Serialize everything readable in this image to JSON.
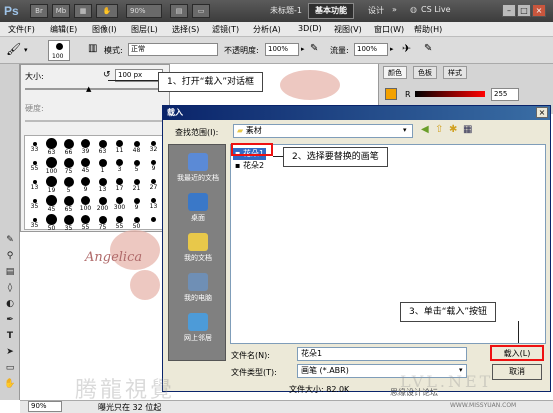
{
  "app": {
    "logo": "Ps",
    "buttons": [
      "Br",
      "Mb"
    ],
    "zoom": "90%",
    "doc_title": "未标题-1",
    "workspace_active": "基本功能",
    "workspace_other": "设计",
    "more": "»",
    "cslive": "CS Live",
    "window_buttons": [
      "–",
      "□",
      "×"
    ]
  },
  "menu": [
    "文件(F)",
    "编辑(E)",
    "图像(I)",
    "图层(L)",
    "选择(S)",
    "滤镜(T)",
    "分析(A)",
    "3D(D)",
    "视图(V)",
    "窗口(W)",
    "帮助(H)"
  ],
  "options": {
    "brush_size": "100",
    "mode_label": "模式:",
    "mode_value": "正常",
    "opacity_label": "不透明度:",
    "opacity_value": "100%",
    "flow_label": "流量:",
    "flow_value": "100%"
  },
  "picker": {
    "size_label": "大小:",
    "size_value": "100 px",
    "hardness_label": "硬度:",
    "brushes": [
      {
        "n": "33"
      },
      {
        "n": "63"
      },
      {
        "n": "66"
      },
      {
        "n": "39"
      },
      {
        "n": "63"
      },
      {
        "n": "11"
      },
      {
        "n": "48"
      },
      {
        "n": "32"
      },
      {
        "n": "55"
      },
      {
        "n": "100"
      },
      {
        "n": "75"
      },
      {
        "n": "45"
      },
      {
        "n": "1"
      },
      {
        "n": "3"
      },
      {
        "n": "5"
      },
      {
        "n": "9"
      },
      {
        "n": "13"
      },
      {
        "n": "19"
      },
      {
        "n": "5"
      },
      {
        "n": "9"
      },
      {
        "n": "13"
      },
      {
        "n": "17"
      },
      {
        "n": "21"
      },
      {
        "n": "27"
      },
      {
        "n": "35"
      },
      {
        "n": "45"
      },
      {
        "n": "65"
      },
      {
        "n": "100"
      },
      {
        "n": "200"
      },
      {
        "n": "300"
      },
      {
        "n": "9"
      },
      {
        "n": "13"
      },
      {
        "n": "35"
      },
      {
        "n": "50"
      },
      {
        "n": "35"
      },
      {
        "n": "55"
      },
      {
        "n": "75"
      },
      {
        "n": "55"
      },
      {
        "n": "50"
      },
      {
        "n": ""
      }
    ]
  },
  "canvas": {
    "text": "Angelica"
  },
  "panels": {
    "tabs": [
      "颜色",
      "色板",
      "样式"
    ],
    "r_label": "R",
    "r_value": "255"
  },
  "status": {
    "zoom": "90%",
    "info": "曝光只在 32 位起"
  },
  "dialog": {
    "title": "载入",
    "lookin_label": "查找范围(I):",
    "lookin_value": "素材",
    "places": [
      "我最近的文档",
      "桌面",
      "我的文档",
      "我的电脑",
      "网上邻居"
    ],
    "files": [
      "花朵1",
      "花朵2"
    ],
    "filename_label": "文件名(N):",
    "filename_value": "花朵1",
    "filetype_label": "文件类型(T):",
    "filetype_value": "画笔 (*.ABR)",
    "filesize": "文件大小: 82.0K",
    "load_button": "载入(L)",
    "cancel_button": "取消"
  },
  "callouts": [
    "1、打开“载入”对话框",
    "2、选择要替换的画笔",
    "3、单击“载入”按钮"
  ],
  "watermark": {
    "left": "腾龍視覺",
    "right": "思缘设计论坛",
    "url": "WWW.MISSYUAN.COM",
    "domain": "LVL.NET"
  }
}
